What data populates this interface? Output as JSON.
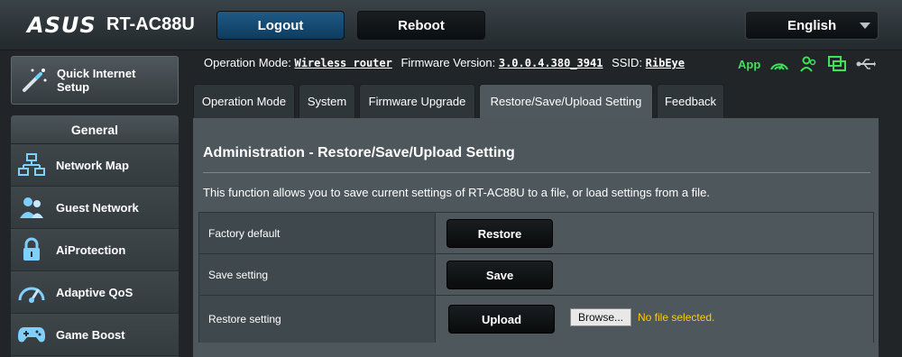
{
  "header": {
    "logo_text": "ASUS",
    "model": "RT-AC88U",
    "logout_label": "Logout",
    "reboot_label": "Reboot",
    "language": "English"
  },
  "sidebar": {
    "quick_setup_label_line1": "Quick Internet",
    "quick_setup_label_line2": "Setup",
    "general_title": "General",
    "items": [
      {
        "label": "Network Map",
        "icon": "network-map-icon"
      },
      {
        "label": "Guest Network",
        "icon": "guest-network-icon"
      },
      {
        "label": "AiProtection",
        "icon": "lock-icon"
      },
      {
        "label": "Adaptive QoS",
        "icon": "speedometer-icon"
      },
      {
        "label": "Game Boost",
        "icon": "gamepad-icon"
      }
    ]
  },
  "status": {
    "operation_mode_label": "Operation Mode:",
    "operation_mode_value": "Wireless router",
    "firmware_label": "Firmware Version:",
    "firmware_value": "3.0.0.4.380_3941",
    "ssid_label": "SSID:",
    "ssid_value": "RibEye",
    "app_label": "App",
    "icons": [
      "wifi-signal-icon",
      "users-icon",
      "monitor-icon",
      "usb-icon"
    ],
    "accent_green": "#3ee35a"
  },
  "tabs": [
    {
      "label": "Operation Mode",
      "active": false
    },
    {
      "label": "System",
      "active": false
    },
    {
      "label": "Firmware Upgrade",
      "active": false
    },
    {
      "label": "Restore/Save/Upload Setting",
      "active": true
    },
    {
      "label": "Feedback",
      "active": false
    }
  ],
  "main": {
    "title": "Administration - Restore/Save/Upload Setting",
    "description": "This function allows you to save current settings of RT-AC88U to a file, or load settings from a file.",
    "rows": [
      {
        "label": "Factory default",
        "button": "Restore"
      },
      {
        "label": "Save setting",
        "button": "Save"
      },
      {
        "label": "Restore setting",
        "button": "Upload",
        "browse_label": "Browse...",
        "file_status": "No file selected."
      }
    ]
  }
}
